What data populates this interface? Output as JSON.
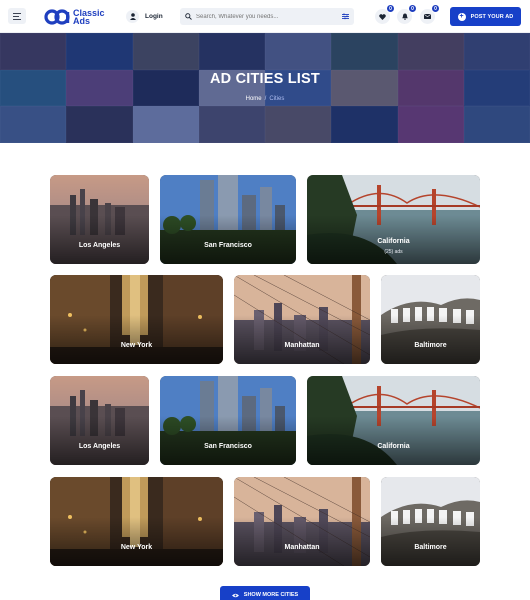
{
  "header": {
    "logo_line1": "Classic",
    "logo_line2": "Ads",
    "login_label": "Login",
    "search_placeholder": "Search, Whatever you needs...",
    "favorites_count": "0",
    "notifications_count": "0",
    "messages_count": "0",
    "post_label": "POST YOUR AD"
  },
  "hero": {
    "title": "AD CITIES LIST",
    "breadcrumb_home": "Home",
    "breadcrumb_current": "Cities"
  },
  "cities": [
    {
      "name": "Los Angeles",
      "count": ""
    },
    {
      "name": "San Francisco",
      "count": ""
    },
    {
      "name": "California",
      "count": "(25) ads"
    },
    {
      "name": "New York",
      "count": ""
    },
    {
      "name": "Manhattan",
      "count": ""
    },
    {
      "name": "Baltimore",
      "count": ""
    },
    {
      "name": "Los Angeles",
      "count": ""
    },
    {
      "name": "San Francisco",
      "count": ""
    },
    {
      "name": "California",
      "count": ""
    },
    {
      "name": "New York",
      "count": ""
    },
    {
      "name": "Manhattan",
      "count": ""
    },
    {
      "name": "Baltimore",
      "count": ""
    }
  ],
  "show_more_label": "SHOW MORE CITIES",
  "colors": {
    "brand": "#1740c8",
    "hero_overlay": "#172b78",
    "card_text": "#ffffff"
  },
  "icons": {
    "menu": "menu-icon",
    "login": "user-icon",
    "search": "search-icon",
    "filter": "filter-icon",
    "favorites": "heart-icon",
    "notifications": "bell-icon",
    "messages": "envelope-icon",
    "post": "plus-icon",
    "show_more": "eye-icon"
  }
}
